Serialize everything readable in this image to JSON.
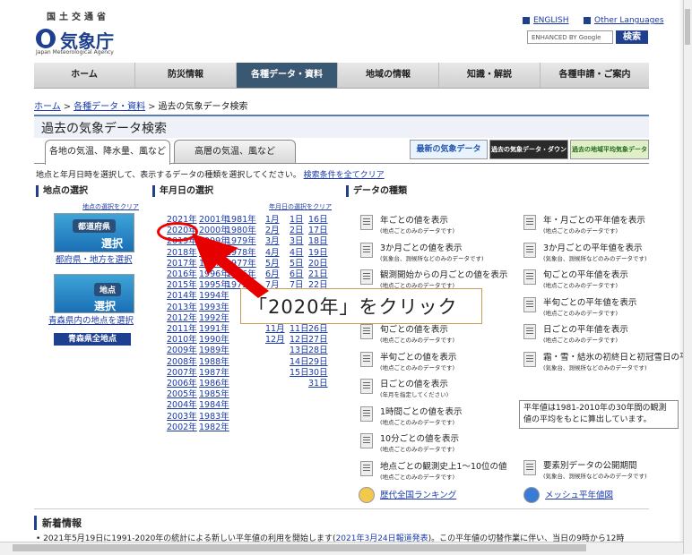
{
  "header": {
    "ministry": "国土交通省",
    "agency": "気象庁",
    "agency_en": "Japan Meteorological Agency",
    "lang_english": "ENGLISH",
    "lang_other": "Other Languages",
    "search_placeholder": "ENHANCED BY Google",
    "search_button": "検索"
  },
  "nav": [
    "ホーム",
    "防災情報",
    "各種データ・資料",
    "地域の情報",
    "知識・解説",
    "各種申請・ご案内"
  ],
  "breadcrumb": [
    "ホーム",
    "各種データ・資料",
    "過去の気象データ検索"
  ],
  "page_title": "過去の気象データ検索",
  "tabs": [
    "各地の気温、降水量、風など",
    "高層の気温、風など"
  ],
  "banners": {
    "latest": "最新の気象データ",
    "download": "過去の気象データ・ダウンロード",
    "normals": "過去の地域平均気象データ"
  },
  "instruction": "地点と年月日時を選択して、表示するデータの種類を選択してください。",
  "clear_all": "検索条件を全てクリア",
  "location": {
    "heading": "地点の選択",
    "clear": "地点の選択をクリア",
    "pref_btn_top": "都道府県",
    "pref_btn_bottom": "選択",
    "pref_link": "都府県・地方を選択",
    "point_btn_top": "地点",
    "point_btn_bottom": "選択",
    "point_link": "青森県内の地点を選択",
    "all_points": "青森県全地点"
  },
  "date": {
    "heading": "年月日の選択",
    "clear": "年月日の選択をクリア",
    "years_col1": [
      "2021年",
      "2020年",
      "2019年",
      "2018年",
      "2017年",
      "2016年",
      "2015年",
      "2014年",
      "2013年",
      "2012年",
      "2011年",
      "2010年",
      "2009年",
      "2008年",
      "2007年",
      "2006年",
      "2005年",
      "2004年",
      "2003年",
      "2002年"
    ],
    "years_col2": [
      "2001年",
      "2000年",
      "1999年",
      "1998年",
      "1997年",
      "1996年",
      "1995年",
      "1994年",
      "1993年",
      "1992年",
      "1991年",
      "1990年",
      "1989年",
      "1988年",
      "1987年",
      "1986年",
      "1985年",
      "1984年",
      "1983年",
      "1982年"
    ],
    "years_col3": [
      "1981年",
      "1980年",
      "1979年",
      "1978年",
      "1977年",
      "1976年",
      "1975年"
    ],
    "months": [
      "1月",
      "2月",
      "3月",
      "4月",
      "5月",
      "6月",
      "7月",
      "8月",
      "9月",
      "10月",
      "11月",
      "12月"
    ],
    "days_col1": [
      "1日",
      "2日",
      "3日",
      "4日",
      "5日",
      "6日",
      "7日",
      "8日",
      "9日",
      "10日",
      "11日",
      "12日",
      "13日",
      "14日",
      "15日"
    ],
    "days_col2": [
      "16日",
      "17日",
      "18日",
      "19日",
      "20日",
      "21日",
      "22日",
      "23日",
      "24日",
      "25日",
      "26日",
      "27日",
      "28日",
      "29日",
      "30日",
      "31日"
    ]
  },
  "data_types": {
    "heading": "データの種類",
    "left": [
      {
        "title": "年ごとの値を表示",
        "sub": "(地点ごとのみのデータです)"
      },
      {
        "title": "3か月ごとの値を表示",
        "sub": "(気象台、測候所などのみのデータです)"
      },
      {
        "title": "観測開始からの月ごとの値を表示",
        "sub": "(地点ごとのみのデータです)"
      },
      {
        "title": "",
        "sub": ""
      },
      {
        "title": "旬ごとの値を表示",
        "sub": "(地点ごとのみのデータです)"
      },
      {
        "title": "半旬ごとの値を表示",
        "sub": "(地点ごとのみのデータです)"
      },
      {
        "title": "日ごとの値を表示",
        "sub": "(年月を指定してください)"
      },
      {
        "title": "1時間ごとの値を表示",
        "sub": "(地点ごとのみのデータです)"
      },
      {
        "title": "10分ごとの値を表示",
        "sub": "(地点ごとのみのデータです)"
      },
      {
        "title": "地点ごとの観測史上1〜10位の値",
        "sub": "(地点ごとのみのデータです)"
      }
    ],
    "right": [
      {
        "title": "年・月ごとの平年値を表示",
        "sub": "(地点ごとのみのデータです)"
      },
      {
        "title": "3か月ごとの平年値を表示",
        "sub": "(気象台、測候所などのみのデータです)"
      },
      {
        "title": "旬ごとの平年値を表示",
        "sub": "(地点ごとのみのデータです)"
      },
      {
        "title": "半旬ごとの平年値を表示",
        "sub": "(地点ごとのみのデータです)"
      },
      {
        "title": "日ごとの平年値を表示",
        "sub": "(地点ごとのみのデータです)"
      },
      {
        "title": "霜・雪・結氷の初終日と初冠雪日の平",
        "sub": "(気象台、測候所などのみのデータです)"
      },
      {
        "title": "要素別データの公開期間",
        "sub": "(気象台、測候所などのみのデータです)"
      }
    ],
    "ranking_link": "歴代全国ランキング",
    "mesh_link": "メッシュ平年値図",
    "note": "平年値は1981-2010年の30年間の観測値の平均をもとに算出しています。"
  },
  "callout": "「2020年」をクリック",
  "news": {
    "heading": "新着情報",
    "line": "• 2021年5月19日に1991-2020年の統計による新しい平年値の利用を開始します(",
    "link": "2021年3月24日報道発表",
    "line_end": ")。この平年値の切替作業に伴い、当日の9時から12時"
  },
  "colors": {
    "brand": "#1f3f8f",
    "nav_active": "#3b5872",
    "link": "#1a3aa8",
    "highlight": "#e00000"
  }
}
